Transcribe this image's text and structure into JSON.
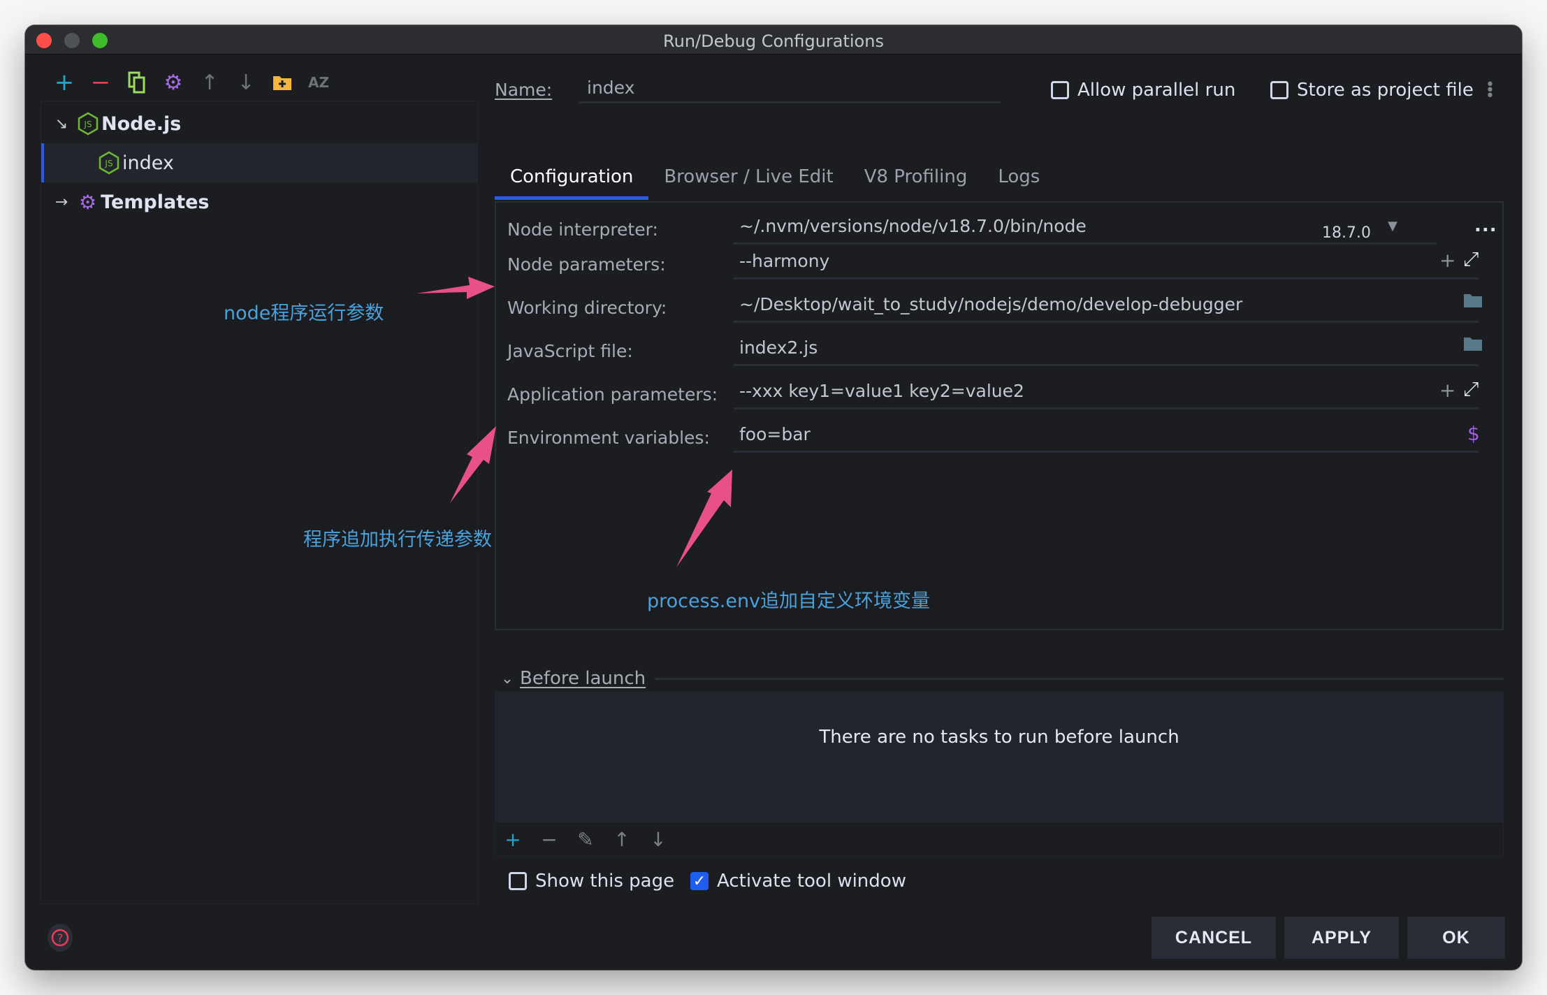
{
  "window": {
    "title": "Run/Debug Configurations"
  },
  "left_toolbar": [
    {
      "name": "add-icon",
      "glyph": "+",
      "color": "#1fa5c9"
    },
    {
      "name": "remove-icon",
      "glyph": "−",
      "color": "#e0424c"
    },
    {
      "name": "copy-icon",
      "glyph": "⧉",
      "color": "#9ddc5f"
    },
    {
      "name": "settings-icon",
      "glyph": "⚙",
      "color": "#a56be0"
    },
    {
      "name": "move-up-icon",
      "glyph": "↑",
      "color": "#6e7179"
    },
    {
      "name": "move-down-icon",
      "glyph": "↓",
      "color": "#6e7179"
    },
    {
      "name": "new-folder-icon",
      "glyph": "📁",
      "color": "#f2b540"
    },
    {
      "name": "sort-icon",
      "glyph": "AZ",
      "color": "#6e7179"
    }
  ],
  "tree": {
    "nodejs": {
      "label": "Node.js",
      "expand": "↘"
    },
    "index": {
      "label": "index"
    },
    "templates": {
      "label": "Templates",
      "expand": "→"
    }
  },
  "name_row": {
    "label": "Name:",
    "value": "index",
    "allow_parallel": {
      "label": "Allow parallel run",
      "checked": false
    },
    "store_project": {
      "label": "Store as project file",
      "checked": false
    }
  },
  "tabs": [
    "Configuration",
    "Browser / Live Edit",
    "V8 Profiling",
    "Logs"
  ],
  "form": {
    "node_interpreter": {
      "label": "Node interpreter:",
      "value": "~/.nvm/versions/node/v18.7.0/bin/node",
      "version": "18.7.0"
    },
    "node_parameters": {
      "label": "Node parameters:",
      "value": "--harmony"
    },
    "working_directory": {
      "label": "Working directory:",
      "value": "~/Desktop/wait_to_study/nodejs/demo/develop-debugger"
    },
    "javascript_file": {
      "label": "JavaScript file:",
      "value": "index2.js"
    },
    "application_parameters": {
      "label": "Application parameters:",
      "value": "--xxx key1=value1 key2=value2"
    },
    "environment_variables": {
      "label": "Environment variables:",
      "value": "foo=bar"
    }
  },
  "annotations": {
    "node_params": "node程序运行参数",
    "app_params": "程序追加执行传递参数",
    "env_vars": "process.env追加自定义环境变量",
    "color": "#4aa2dc",
    "arrow_color": "#e8508a"
  },
  "before_launch": {
    "title": "Before launch",
    "empty_text": "There are no tasks to run before launch"
  },
  "options": {
    "show_page": {
      "label": "Show this page",
      "checked": false
    },
    "activate_tool": {
      "label": "Activate tool window",
      "checked": true
    }
  },
  "buttons": {
    "cancel": "CANCEL",
    "apply": "APPLY",
    "ok": "OK"
  }
}
